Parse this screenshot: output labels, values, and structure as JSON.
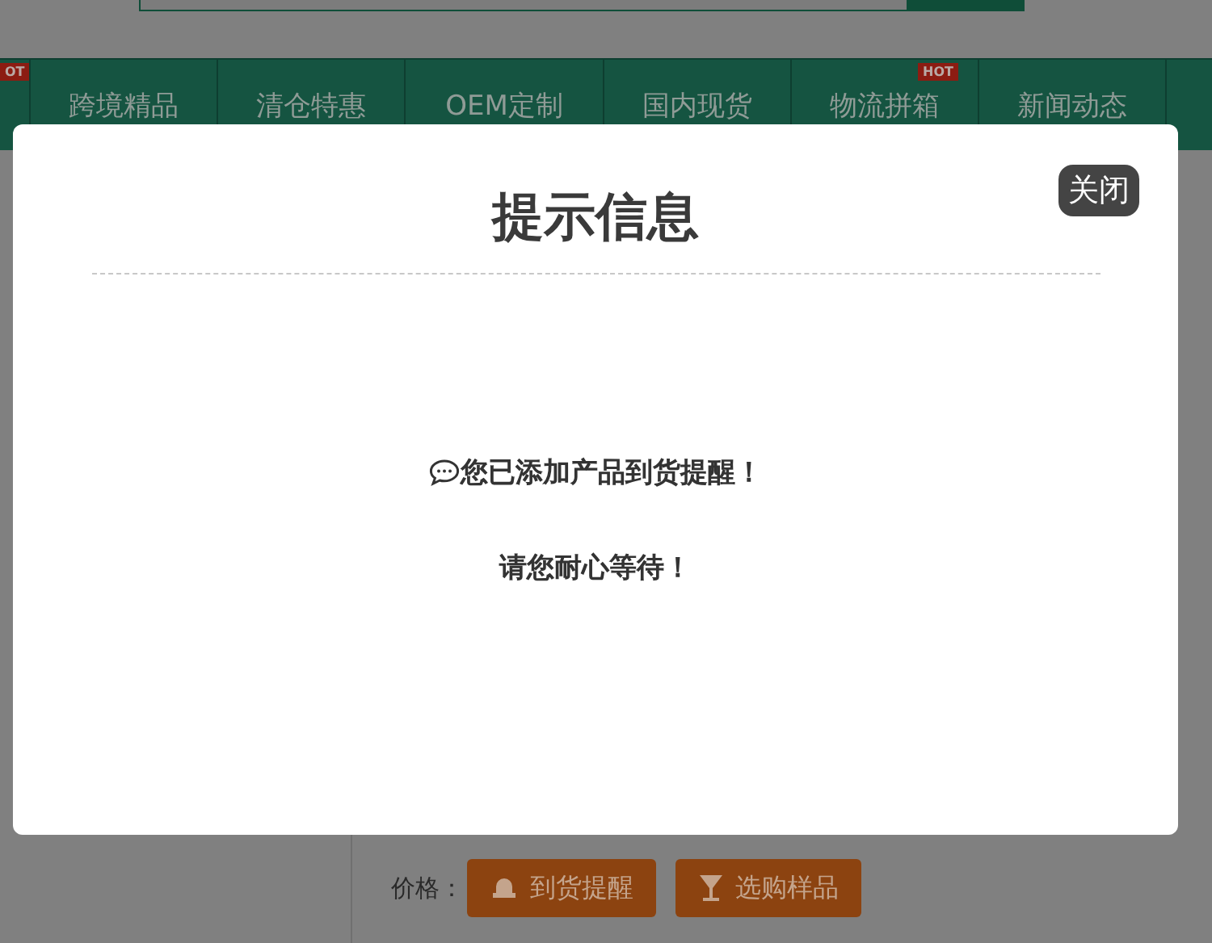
{
  "nav": {
    "partial_badge": "OT",
    "items": [
      {
        "label": "跨境精品"
      },
      {
        "label": "清仓特惠"
      },
      {
        "label": "OEM定制"
      },
      {
        "label": "国内现货"
      },
      {
        "label": "物流拼箱",
        "badge": "HOT"
      },
      {
        "label": "新闻动态"
      }
    ]
  },
  "modal": {
    "title": "提示信息",
    "close_button": "关闭",
    "messages": [
      {
        "text": "您已添加产品到货提醒！",
        "kind": "icon"
      },
      {
        "text": "请您耐心等待！",
        "kind": "plain"
      }
    ]
  },
  "product": {
    "price_label": "价格：",
    "buttons": [
      {
        "label": "到货提醒",
        "kind": "alert"
      },
      {
        "label": "选购样品",
        "kind": "sample"
      }
    ]
  }
}
